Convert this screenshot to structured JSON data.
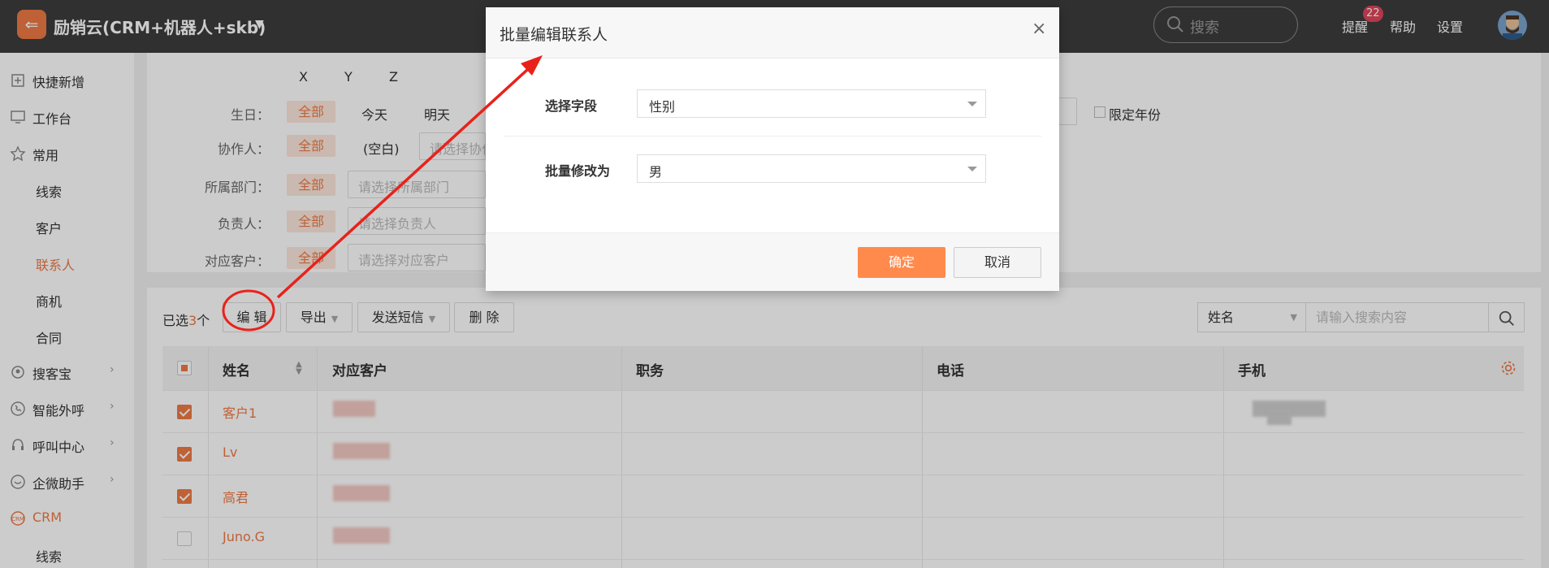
{
  "app": {
    "title": "励销云(CRM+机器人+skb)",
    "search_placeholder": "搜索",
    "nav": {
      "remind": "提醒",
      "remind_count": "22",
      "help": "帮助",
      "settings": "设置"
    }
  },
  "sidebar": {
    "items": [
      {
        "label": "快捷新增",
        "icon": "plus-square-icon"
      },
      {
        "label": "工作台",
        "icon": "monitor-icon"
      },
      {
        "label": "常用",
        "icon": "star-icon"
      },
      {
        "label": "线索"
      },
      {
        "label": "客户"
      },
      {
        "label": "联系人"
      },
      {
        "label": "商机"
      },
      {
        "label": "合同"
      },
      {
        "label": "搜客宝",
        "icon": "search-user-icon",
        "arrow": "›"
      },
      {
        "label": "智能外呼",
        "icon": "phone-icon",
        "arrow": "›"
      },
      {
        "label": "呼叫中心",
        "icon": "headset-icon",
        "arrow": "›"
      },
      {
        "label": "企微助手",
        "icon": "chat-icon",
        "arrow": "›"
      },
      {
        "label": "CRM",
        "icon": "crm-icon"
      },
      {
        "label": "线索"
      }
    ]
  },
  "filters": {
    "letters": [
      "X",
      "Y",
      "Z"
    ],
    "birthday": {
      "label": "生日：",
      "all": "全部",
      "opts": [
        "今天",
        "明天"
      ],
      "limit_year": "限定年份"
    },
    "collab": {
      "label": "协作人：",
      "all": "全部",
      "blank": "(空白)",
      "placeholder": "请选择协作人"
    },
    "dept": {
      "label": "所属部门：",
      "all": "全部",
      "placeholder": "请选择所属部门"
    },
    "owner": {
      "label": "负责人：",
      "all": "全部",
      "placeholder": "请选择负责人"
    },
    "customer": {
      "label": "对应客户：",
      "all": "全部",
      "placeholder": "请选择对应客户"
    }
  },
  "toolbar": {
    "selected_prefix": "已选",
    "selected_count": "3",
    "selected_suffix": "个",
    "edit": "编 辑",
    "export": "导出",
    "sms": "发送短信",
    "delete": "删 除",
    "search_field": "姓名",
    "search_placeholder": "请输入搜索内容"
  },
  "table": {
    "headers": [
      "姓名",
      "对应客户",
      "职务",
      "电话",
      "手机"
    ],
    "rows": [
      {
        "name": "客户1",
        "checked": true
      },
      {
        "name": "Lv",
        "checked": true
      },
      {
        "name": "高君",
        "checked": true
      },
      {
        "name": "Juno.G",
        "checked": false
      }
    ]
  },
  "modal": {
    "title": "批量编辑联系人",
    "close": "×",
    "field_label": "选择字段",
    "field_value": "性别",
    "change_label": "批量修改为",
    "change_value": "男",
    "ok": "确定",
    "cancel": "取消"
  },
  "colors": {
    "accent": "#ee7a45",
    "annotation": "#e8221b"
  }
}
